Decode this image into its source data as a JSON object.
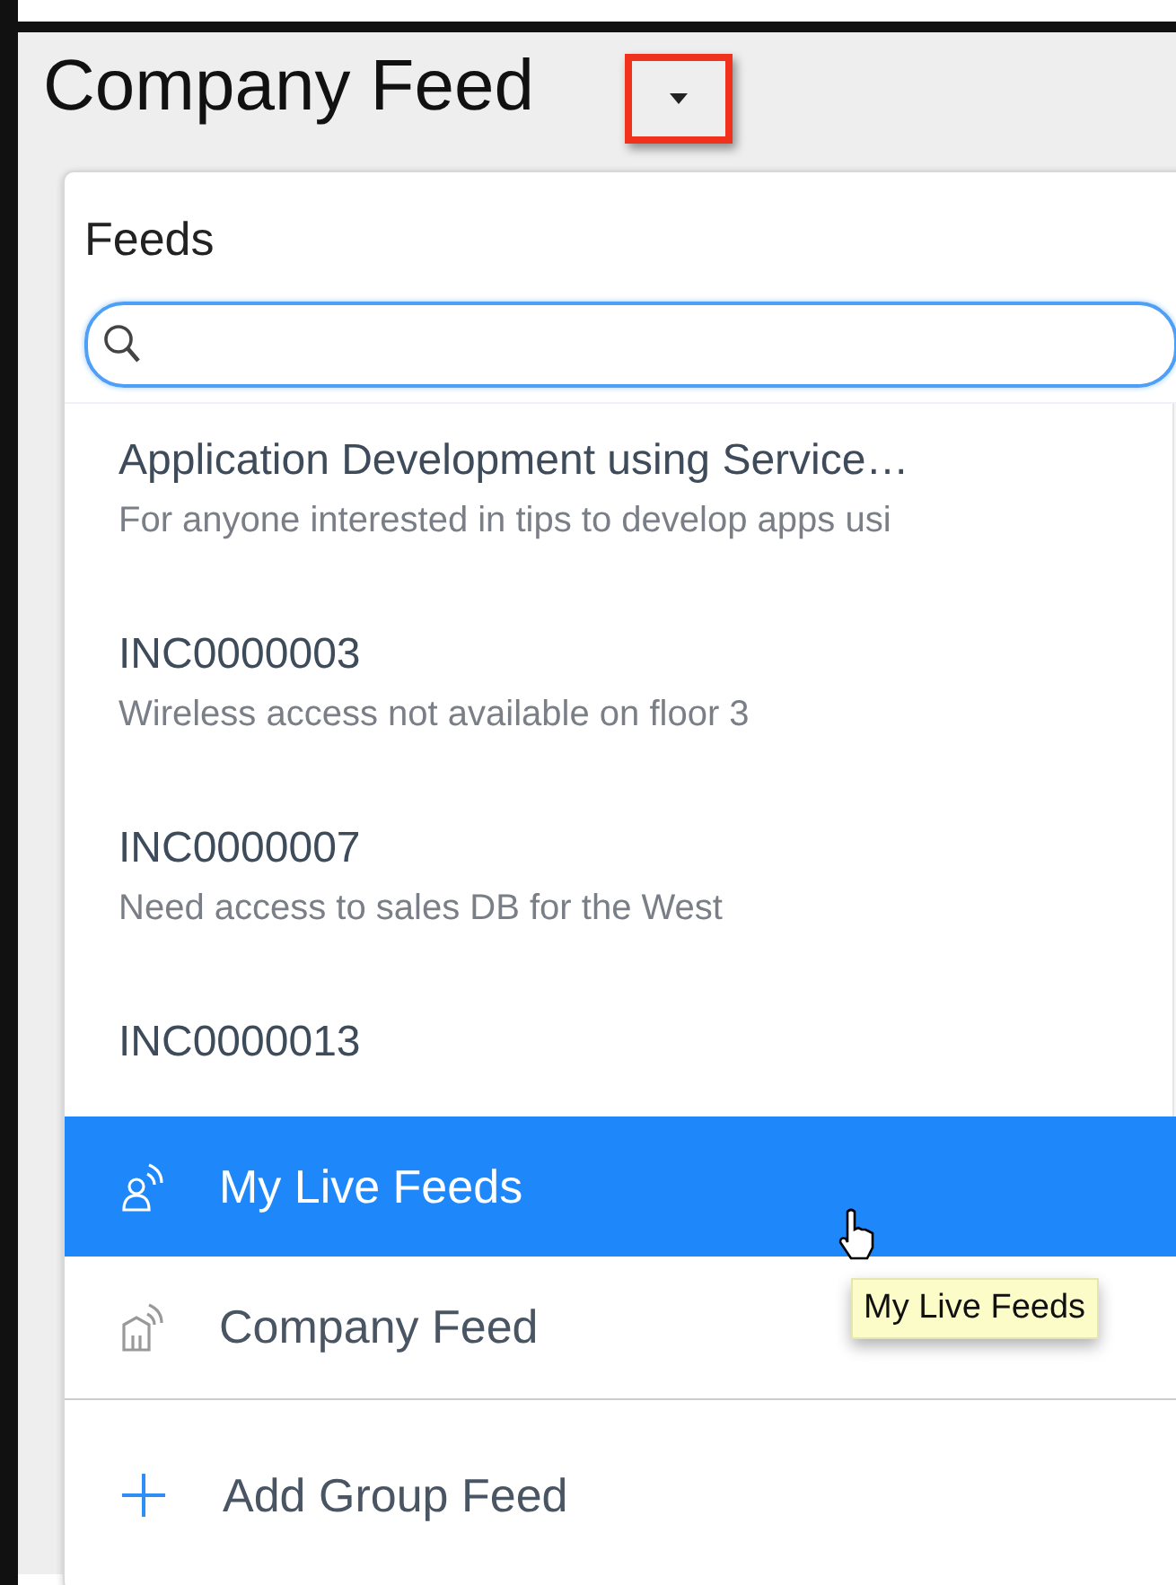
{
  "header": {
    "title": "Company Feed"
  },
  "feeds_panel": {
    "title": "Feeds",
    "groups": [
      {
        "title": "Application Development using Service…",
        "description": "For anyone interested in tips to develop apps usi"
      },
      {
        "title": "INC0000003",
        "description": "Wireless access not available on floor 3"
      },
      {
        "title": "INC0000007",
        "description": "Need access to sales DB for the West"
      },
      {
        "title": "INC0000013"
      }
    ],
    "feed_types": [
      {
        "kind": "live",
        "label": "My Live Feeds",
        "selected": true
      },
      {
        "kind": "company",
        "label": "Company Feed",
        "selected": false
      }
    ],
    "add_action": {
      "label": "Add Group Feed"
    }
  },
  "tooltip": {
    "text": "My Live Feeds"
  }
}
